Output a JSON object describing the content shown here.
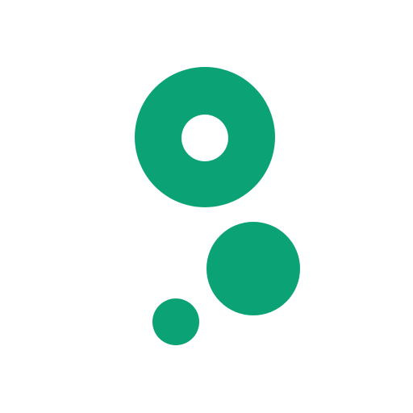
{
  "logo": {
    "icon": "bubbles-logo-icon",
    "color": "#0ba376",
    "background": "#ffffff"
  }
}
